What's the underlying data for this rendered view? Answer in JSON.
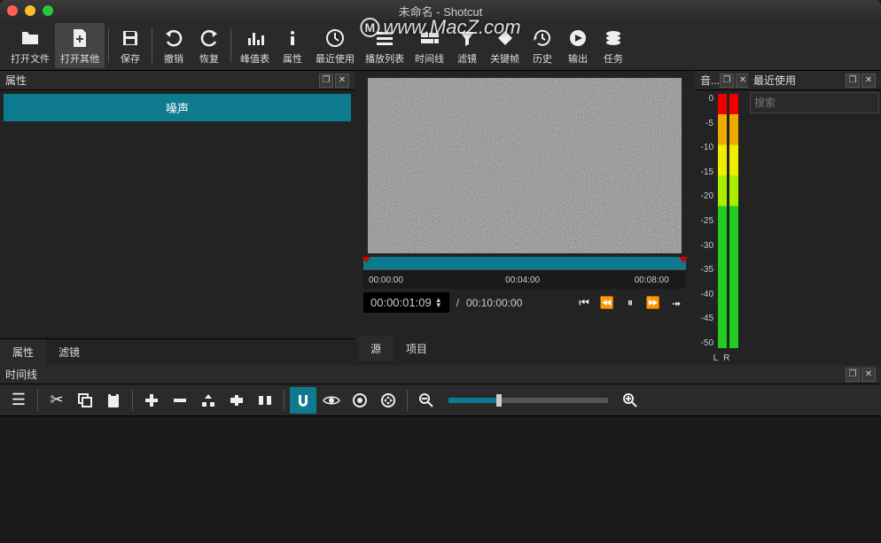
{
  "window": {
    "title": "未命名 - Shotcut"
  },
  "watermark": "www.MacZ.com",
  "toolbar": {
    "open_file": "打开文件",
    "open_other": "打开其他",
    "save": "保存",
    "undo": "撤销",
    "redo": "恢复",
    "peak_meter": "峰值表",
    "properties": "属性",
    "recent": "最近使用",
    "playlist": "播放列表",
    "timeline": "时间线",
    "filters": "滤镜",
    "keyframes": "关键帧",
    "history": "历史",
    "export": "输出",
    "jobs": "任务"
  },
  "left_panel": {
    "title": "属性",
    "item": "噪声",
    "tabs": {
      "properties": "属性",
      "filters": "滤镜"
    }
  },
  "center": {
    "ruler": {
      "t0": "00:00:00",
      "t1": "00:04:00",
      "t2": "00:08:00"
    },
    "timecode": "00:00:01:09",
    "duration": "00:10:00:00",
    "tabs": {
      "source": "源",
      "project": "项目"
    }
  },
  "meter": {
    "title": "音...",
    "scale": [
      "0",
      "-5",
      "-10",
      "-15",
      "-20",
      "-25",
      "-30",
      "-35",
      "-40",
      "-45",
      "-50"
    ],
    "L": "L",
    "R": "R"
  },
  "recent": {
    "title": "最近使用",
    "search_placeholder": "搜索"
  },
  "timeline": {
    "title": "时间线"
  }
}
